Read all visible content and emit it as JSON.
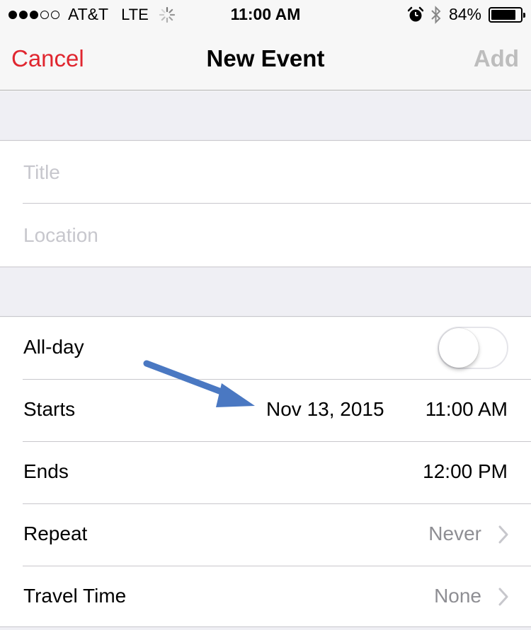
{
  "status_bar": {
    "signal_dots_filled": 3,
    "signal_dots_total": 5,
    "carrier": "AT&T",
    "network": "LTE",
    "time": "11:00 AM",
    "battery_percent_label": "84%",
    "battery_level": 0.84,
    "icons": [
      "activity-spinner-icon",
      "alarm-icon",
      "bluetooth-icon",
      "battery-icon"
    ]
  },
  "nav": {
    "cancel_label": "Cancel",
    "title": "New Event",
    "add_label": "Add"
  },
  "fields": {
    "title_placeholder": "Title",
    "title_value": "",
    "location_placeholder": "Location",
    "location_value": ""
  },
  "rows": {
    "all_day": {
      "label": "All-day",
      "enabled": false
    },
    "starts": {
      "label": "Starts",
      "date": "Nov 13, 2015",
      "time": "11:00 AM"
    },
    "ends": {
      "label": "Ends",
      "time": "12:00 PM"
    },
    "repeat": {
      "label": "Repeat",
      "value": "Never"
    },
    "travel_time": {
      "label": "Travel Time",
      "value": "None"
    }
  },
  "colors": {
    "accent_red": "#e0262f",
    "disabled_gray": "#bdbdbd",
    "annotation_arrow": "#4a78c2"
  }
}
